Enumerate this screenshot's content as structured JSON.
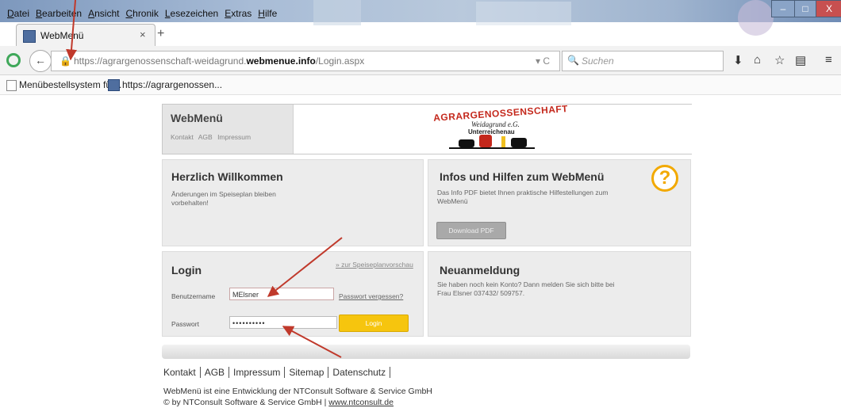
{
  "window": {
    "menu": [
      "Datei",
      "Bearbeiten",
      "Ansicht",
      "Chronik",
      "Lesezeichen",
      "Extras",
      "Hilfe"
    ],
    "minimize_glyph": "–",
    "maximize_glyph": "□",
    "close_glyph": "X"
  },
  "tab": {
    "title": "WebMenü",
    "close_glyph": "×",
    "new_tab_glyph": "+"
  },
  "navbar": {
    "back_glyph": "←",
    "url_prefix": "https://agrargenossenschaft-weidagrund.",
    "url_domain": "webmenue.info",
    "url_suffix": "/Login.aspx",
    "url_tools": "▾ C",
    "search_placeholder": "Suchen",
    "icons": [
      "download-icon",
      "home-icon",
      "star-icon",
      "reading-list-icon",
      "menu-icon"
    ]
  },
  "bookmarks": [
    "Menübestellsystem für...",
    "https://agrargenossen..."
  ],
  "header": {
    "title": "WebMenü",
    "links": [
      "Kontakt",
      "AGB",
      "Impressum"
    ],
    "logo": {
      "line1": "AGRARGENOSSENSCHAFT",
      "line2": "Weidagrund e.G.",
      "line3": "Unterreichenau"
    }
  },
  "welcome": {
    "title": "Herzlich Willkommen",
    "text": "Änderungen im Speiseplan bleiben vorbehalten!"
  },
  "info": {
    "title": "Infos und Hilfen zum WebMenü",
    "text": "Das Info PDF bietet Ihnen praktische Hilfestellungen zum WebMenü",
    "button": "Download PDF",
    "help_glyph": "?"
  },
  "login": {
    "title": "Login",
    "preview_link": "» zur Speiseplanvorschau",
    "username_label": "Benutzername",
    "username_value": "MElsner",
    "forgot_link": "Passwort vergessen?",
    "password_label": "Passwort",
    "password_value": "••••••••••",
    "button": "Login"
  },
  "register": {
    "title": "Neuanmeldung",
    "text": "Sie haben noch kein Konto? Dann melden Sie sich bitte bei Frau Elsner 037432/ 509757."
  },
  "footer": {
    "links": [
      "Kontakt",
      "AGB",
      "Impressum",
      "Sitemap",
      "Datenschutz"
    ],
    "dev": "WebMenü ist eine Entwicklung der NTConsult Software & Service GmbH",
    "copy": "© by NTConsult Software & Service GmbH | ",
    "copy_link": "www.ntconsult.de"
  },
  "colors": {
    "annotation_arrow": "#c0392b",
    "login_button": "#f6c50e",
    "help_icon": "#f2a900"
  }
}
